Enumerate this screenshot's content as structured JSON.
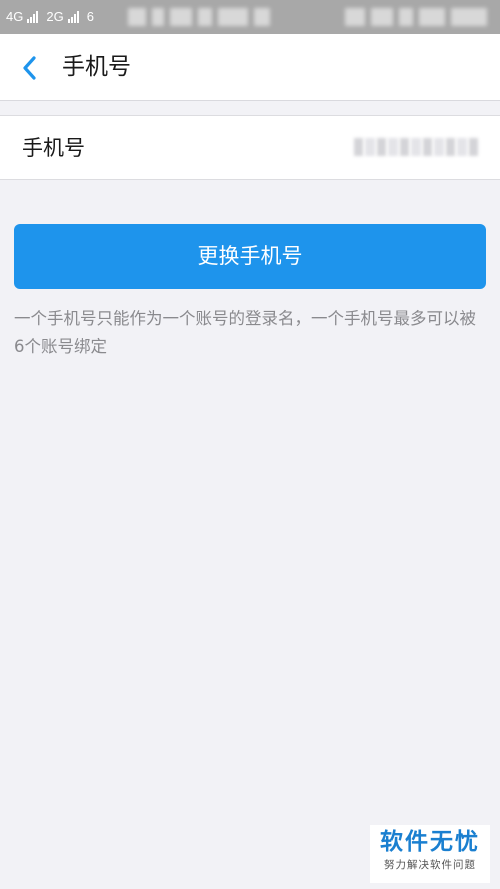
{
  "status_bar": {
    "network_1": "4G",
    "network_2": "2G",
    "extra": "6"
  },
  "nav": {
    "back_icon": "chevron-left-icon",
    "title": "手机号"
  },
  "phone_row": {
    "label": "手机号",
    "value_redacted": true
  },
  "change_button": {
    "label": "更换手机号",
    "color": "#1e94ec"
  },
  "hint": {
    "text": "一个手机号只能作为一个账号的登录名，一个手机号最多可以被6个账号绑定"
  },
  "watermark": {
    "main": "软件无忧",
    "sub": "努力解决软件问题"
  },
  "colors": {
    "background": "#f2f2f6",
    "accent": "#1e94ec",
    "status_bar": "#a8a8a8"
  }
}
